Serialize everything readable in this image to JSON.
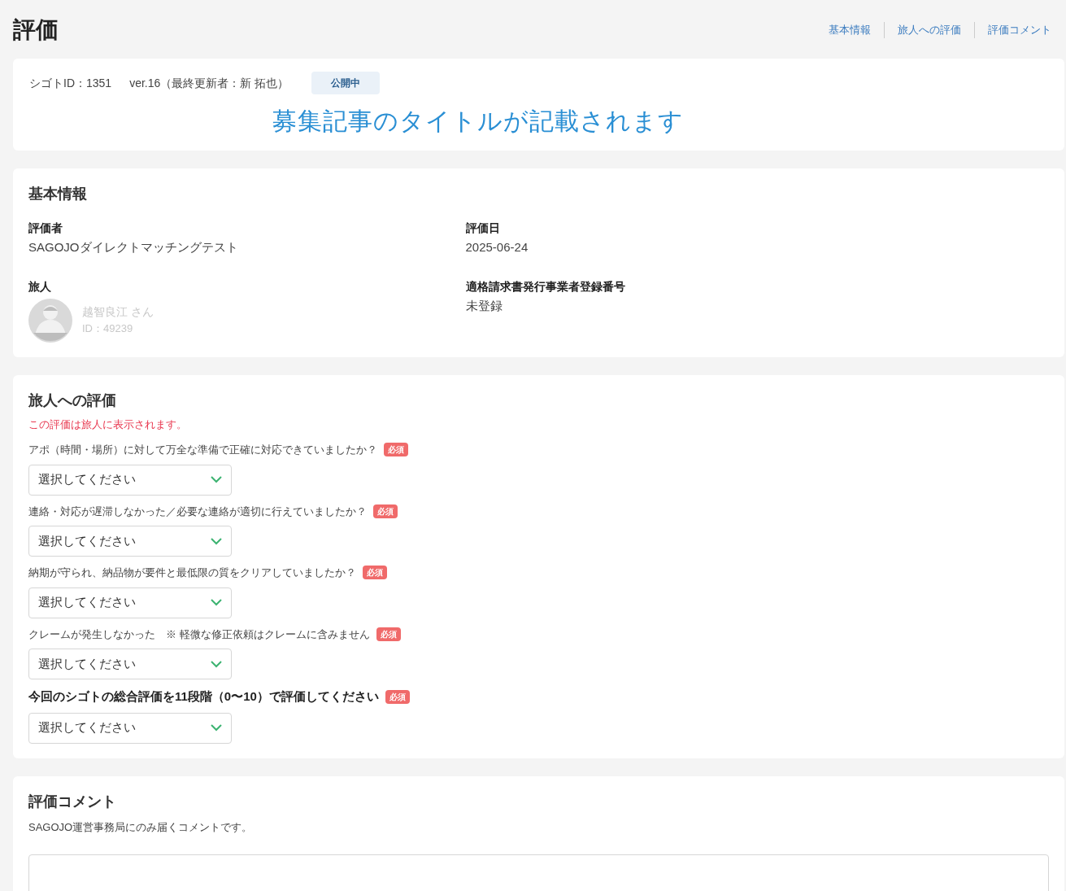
{
  "page_title": "評価",
  "anchor_links": [
    "基本情報",
    "旅人への評価",
    "評価コメント"
  ],
  "header_card": {
    "shigoto_id": "シゴトID：1351",
    "version": "ver.16（最終更新者：新 拓也）",
    "status_badge": "公開中",
    "title_text": "募集記事のタイトルが記載されます"
  },
  "basic_info": {
    "heading": "基本情報",
    "fields": [
      {
        "label": "評価者",
        "value": "SAGOJOダイレクトマッチングテスト"
      },
      {
        "label": "評価日",
        "value": "2025-06-24"
      },
      {
        "label": "旅人",
        "kind": "person",
        "name": "越智良江 さん",
        "id": "ID：49239"
      },
      {
        "label": "適格請求書発行事業者登録番号",
        "value": "未登録"
      }
    ]
  },
  "traveler_review": {
    "heading": "旅人への評価",
    "notice": "この評価は旅人に表示されます。",
    "questions": [
      {
        "label": "アポ（時間・場所）に対して万全な準備で正確に対応できていましたか？",
        "bold": false,
        "required_badge": "必須",
        "placeholder": "選択してください"
      },
      {
        "label": "連絡・対応が遅滞しなかった／必要な連絡が適切に行えていましたか？",
        "bold": false,
        "required_badge": "必須",
        "placeholder": "選択してください"
      },
      {
        "label": "納期が守られ、納品物が要件と最低限の質をクリアしていましたか？",
        "bold": false,
        "required_badge": "必須",
        "placeholder": "選択してください"
      },
      {
        "label": "クレームが発生しなかった　※ 軽微な修正依頼はクレームに含みません",
        "bold": false,
        "required_badge": "必須",
        "placeholder": "選択してください"
      },
      {
        "label": "今回のシゴトの総合評価を11段階（0〜10）で評価してください",
        "bold": true,
        "required_badge": "必須",
        "placeholder": "選択してください"
      }
    ]
  },
  "comment": {
    "heading": "評価コメント",
    "description": "SAGOJO運営事務局にのみ届くコメントです。"
  }
}
